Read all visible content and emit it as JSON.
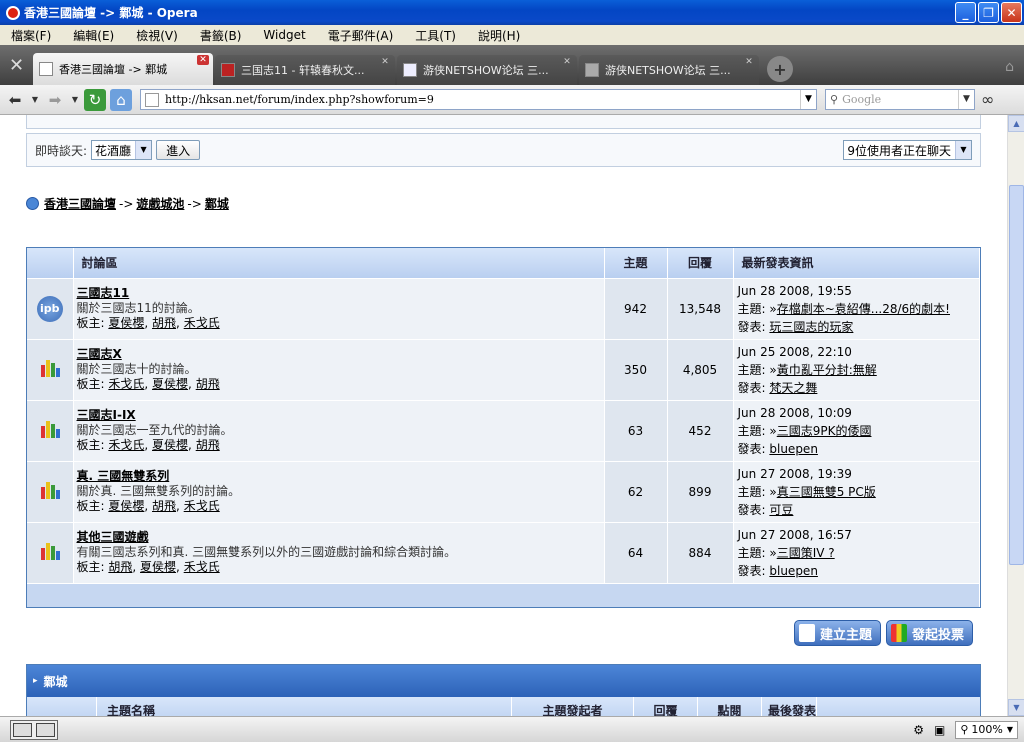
{
  "window": {
    "title": "香港三國論壇 -> 鄴城 - Opera",
    "min": "_",
    "max": "❐",
    "close": "✕"
  },
  "menu": [
    "檔案(F)",
    "編輯(E)",
    "檢視(V)",
    "書籤(B)",
    "Widget",
    "電子郵件(A)",
    "工具(T)",
    "說明(H)"
  ],
  "tabs": [
    {
      "label": "香港三國論壇 -> 鄴城",
      "active": true
    },
    {
      "label": "三国志11 - 轩辕春秋文..."
    },
    {
      "label": "游侠NETSHOW论坛 三..."
    },
    {
      "label": "游侠NETSHOW论坛 三..."
    }
  ],
  "address": {
    "url": "http://hksan.net/forum/index.php?showforum=9",
    "search_placeholder": "Google"
  },
  "page": {
    "top_strip": "...............................................................................................",
    "chat": {
      "label": "即時談天:",
      "room": "花酒廳",
      "enter": "進入",
      "users": "9位使用者正在聊天"
    },
    "breadcrumb": [
      "香港三國論壇",
      "遊戲城池",
      "鄴城"
    ],
    "breadcrumb_sep": "->",
    "table_headers": {
      "forum": "討論區",
      "topics": "主題",
      "replies": "回覆",
      "last": "最新發表資訊"
    },
    "labels": {
      "mods": "板主:",
      "topic": "主題:",
      "poster": "發表:",
      "arrow": "»"
    },
    "forums": [
      {
        "icon": "ipb",
        "name": "三國志11",
        "desc": "關於三國志11的討論。",
        "mods": [
          "夏侯櫻",
          "胡飛",
          "禾戈氏"
        ],
        "topics": "942",
        "replies": "13,548",
        "date": "Jun 28 2008, 19:55",
        "last_topic": "存檔劇本~袁紹傳...28/6的劇本!",
        "last_poster": "玩三國志的玩家"
      },
      {
        "icon": "bars",
        "name": "三國志X",
        "desc": "關於三國志十的討論。",
        "mods": [
          "禾戈氏",
          "夏侯櫻",
          "胡飛"
        ],
        "topics": "350",
        "replies": "4,805",
        "date": "Jun 25 2008, 22:10",
        "last_topic": "黃巾亂平分封:無解",
        "last_poster": "梵天之舞"
      },
      {
        "icon": "bars",
        "name": "三國志I-IX",
        "desc": "關於三國志一至九代的討論。",
        "mods": [
          "禾戈氏",
          "夏侯櫻",
          "胡飛"
        ],
        "topics": "63",
        "replies": "452",
        "date": "Jun 28 2008, 10:09",
        "last_topic": "三國志9PK的倭國",
        "last_poster": "bluepen"
      },
      {
        "icon": "bars",
        "name": "真. 三國無雙系列",
        "desc": "關於真. 三國無雙系列的討論。",
        "mods": [
          "夏侯櫻",
          "胡飛",
          "禾戈氏"
        ],
        "topics": "62",
        "replies": "899",
        "date": "Jun 27 2008, 19:39",
        "last_topic": "真三國無雙5 PC版",
        "last_poster": "可豆"
      },
      {
        "icon": "bars",
        "name": "其他三國遊戲",
        "desc": "有關三國志系列和真. 三國無雙系列以外的三國遊戲討論和綜合類討論。",
        "mods": [
          "胡飛",
          "夏侯櫻",
          "禾戈氏"
        ],
        "topics": "64",
        "replies": "884",
        "date": "Jun 27 2008, 16:57",
        "last_topic": "三國策IV ?",
        "last_poster": "bluepen"
      }
    ],
    "buttons": {
      "new_topic": "建立主題",
      "new_poll": "發起投票"
    },
    "subforum": {
      "title": "鄴城",
      "cols": [
        "主題名稱",
        "主題發起者",
        "回覆",
        "點閱",
        "最後發表"
      ]
    }
  },
  "status": {
    "zoom": "100%"
  }
}
